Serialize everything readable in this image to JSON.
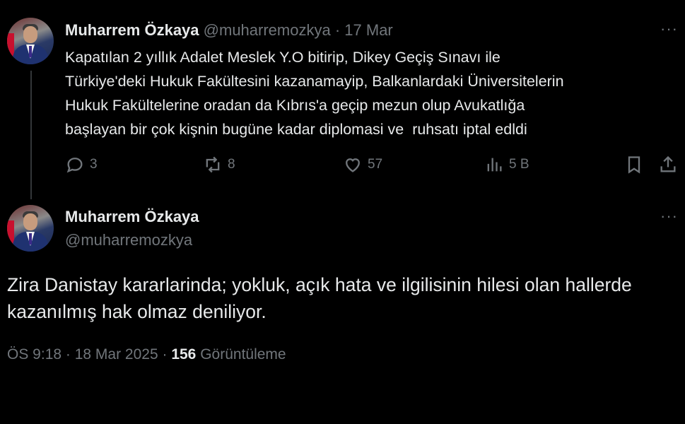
{
  "tweet1": {
    "author_name": "Muharrem Özkaya",
    "handle": "@muharremozkya",
    "separator": " · ",
    "date": "17 Mar",
    "more": "···",
    "text": "Kapatılan 2 yıllık Adalet Meslek Y.O bitirip, Dikey Geçiş Sınavı ile\nTürkiye'deki Hukuk Fakültesini kazanamayip, Balkanlardaki Üniversitelerin\nHukuk Fakültelerine oradan da Kıbrıs'a geçip mezun olup Avukatlığa\nbaşlayan bir çok kişnin bugüne kadar diplomasi ve  ruhsatı iptal edldi",
    "actions": {
      "replies": "3",
      "reposts": "8",
      "likes": "57",
      "views": "5 B"
    }
  },
  "tweet2": {
    "author_name": "Muharrem Özkaya",
    "handle": "@muharremozkya",
    "more": "···",
    "text": "Zira Danistay kararlarinda; yokluk,  açık hata ve ilgilisinin hilesi olan hallerde kazanılmış hak olmaz deniliyor.",
    "time": "ÖS 9:18",
    "sep1": " · ",
    "date": "18 Mar 2025",
    "sep2": " · ",
    "view_count": "156",
    "view_label": " Görüntüleme"
  },
  "icons": [
    "reply-icon",
    "repost-icon",
    "like-icon",
    "views-icon",
    "bookmark-icon",
    "share-icon",
    "more-icon"
  ]
}
